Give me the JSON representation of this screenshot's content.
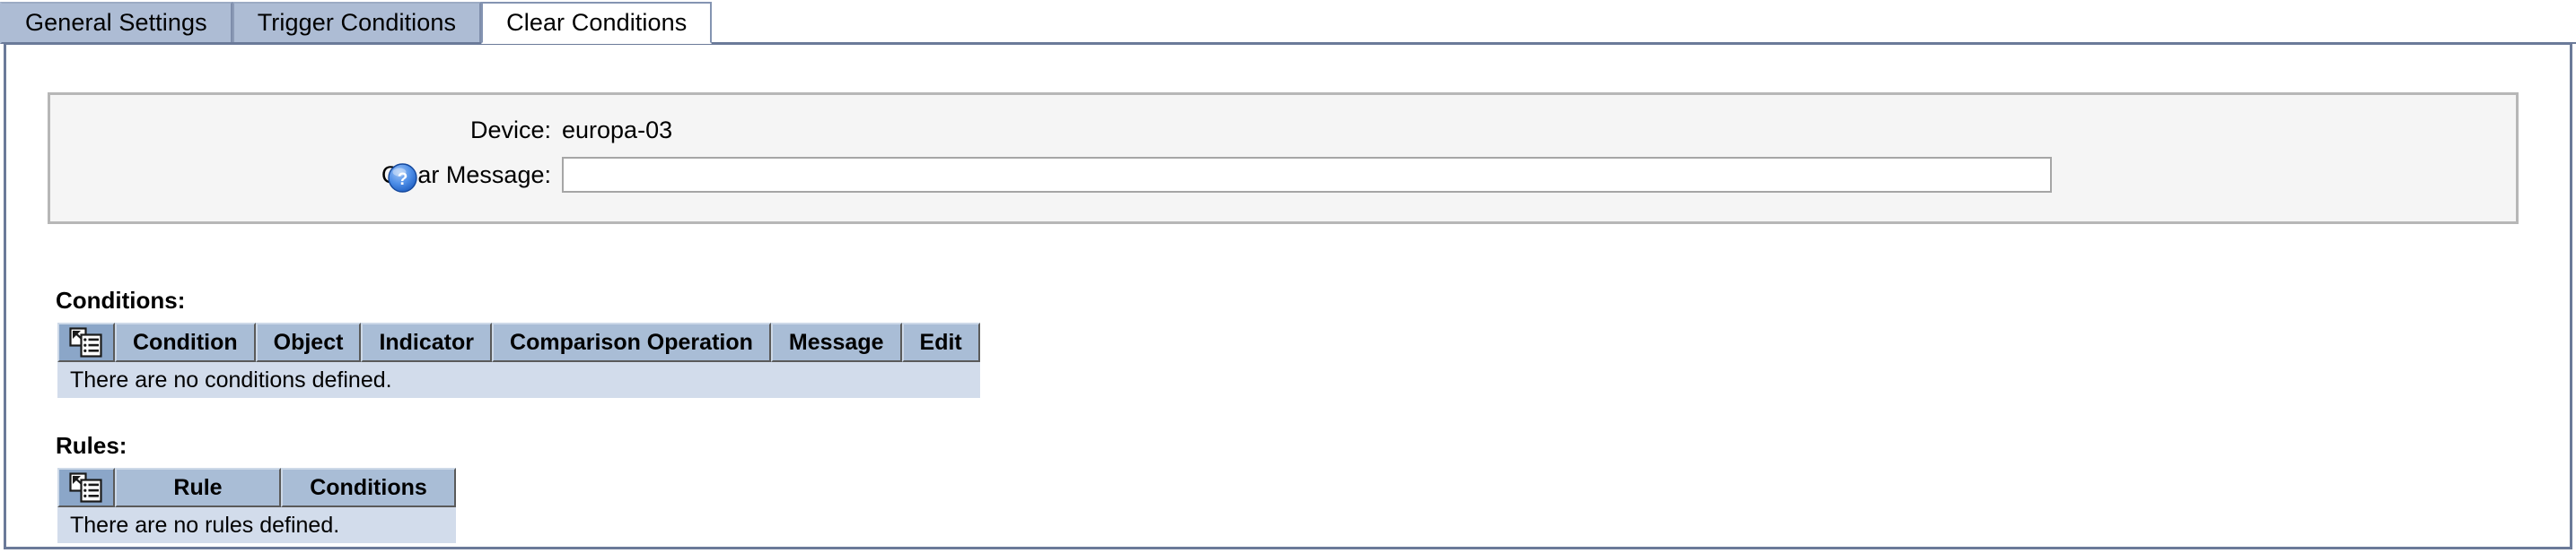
{
  "tabs": [
    {
      "label": "General Settings",
      "active": false,
      "name": "tab-general-settings"
    },
    {
      "label": "Trigger Conditions",
      "active": false,
      "name": "tab-trigger-conditions"
    },
    {
      "label": "Clear Conditions",
      "active": true,
      "name": "tab-clear-conditions"
    }
  ],
  "info": {
    "device_label": "Device:",
    "device_value": "europa-03",
    "clear_message_label": "Clear Message:",
    "clear_message_value": "",
    "clear_message_placeholder": "",
    "help_icon": "help-question-icon"
  },
  "conditions": {
    "section_label": "Conditions:",
    "icon": "new-list-item-icon",
    "columns": [
      "Condition",
      "Object",
      "Indicator",
      "Comparison Operation",
      "Message",
      "Edit"
    ],
    "rows": [],
    "empty_text": "There are no conditions defined."
  },
  "rules": {
    "section_label": "Rules:",
    "icon": "new-list-item-icon",
    "columns": [
      "Rule",
      "Conditions"
    ],
    "rows": [],
    "empty_text": "There are no rules defined."
  },
  "colors": {
    "tab_inactive": "#adbcd4",
    "tab_active": "#ffffff",
    "panel_border": "#6b7a99",
    "table_header": "#a9bdd6",
    "table_icon_header": "#8ba6c8",
    "table_empty_row": "#d2dceb",
    "infobox_bg": "#f5f5f5",
    "infobox_border": "#b7b7b7",
    "help_icon_blue": "#3b7ddd"
  }
}
